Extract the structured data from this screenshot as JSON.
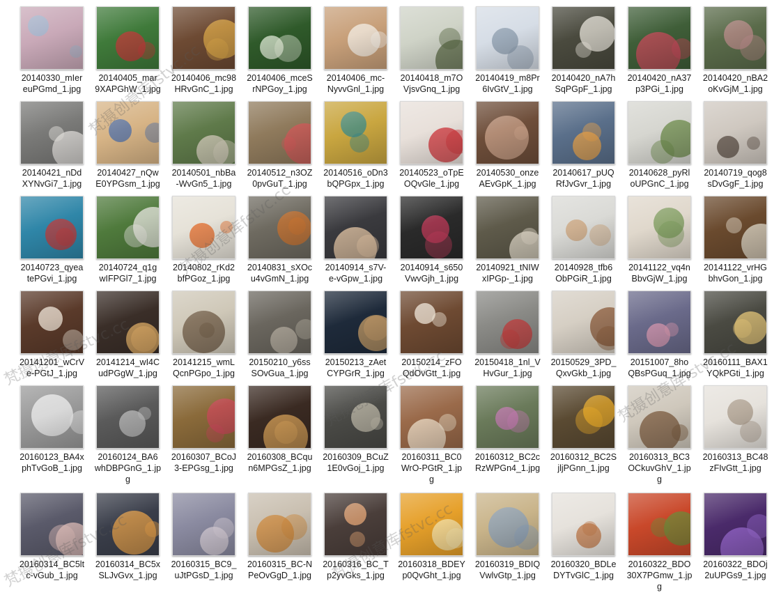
{
  "files": [
    {
      "name": "20140330_mIer euPGmd_1.jpg",
      "line1": "20140330_mIer",
      "line2": "euPGmd_1.jpg",
      "line3": "",
      "color": "#c9a9b8",
      "accent": "#9db7cf"
    },
    {
      "name": "20140405_mar 9XAPGhW_1.jpg",
      "line1": "20140405_mar",
      "line2": "9XAPGhW_1.jpg",
      "line3": "",
      "color": "#3f7a3a",
      "accent": "#c23b3b"
    },
    {
      "name": "20140406_mc98 HRvGnC_1.jpg",
      "line1": "20140406_mc98",
      "line2": "HRvGnC_1.jpg",
      "line3": "",
      "color": "#6d4a33",
      "accent": "#d9a74a"
    },
    {
      "name": "20140406_mceS rNPGoy_1.jpg",
      "line1": "20140406_mceS",
      "line2": "rNPGoy_1.jpg",
      "line3": "",
      "color": "#2f5a2a",
      "accent": "#dfe9d5"
    },
    {
      "name": "20140406_mc- NyvvGnl_1.jpg",
      "line1": "20140406_mc-",
      "line2": "NyvvGnl_1.jpg",
      "line3": "",
      "color": "#c8a07a",
      "accent": "#f3ede6"
    },
    {
      "name": "20140418_m7O VjsvGnq_1.jpg",
      "line1": "20140418_m7O",
      "line2": "VjsvGnq_1.jpg",
      "line3": "",
      "color": "#cfd3c7",
      "accent": "#5c6b47"
    },
    {
      "name": "20140419_m8Pr 6IvGtV_1.jpg",
      "line1": "20140419_m8Pr",
      "line2": "6IvGtV_1.jpg",
      "line3": "",
      "color": "#d6dde6",
      "accent": "#8a9aab"
    },
    {
      "name": "20140420_nA7h SqPGpF_1.jpg",
      "line1": "20140420_nA7h",
      "line2": "SqPGpF_1.jpg",
      "line3": "",
      "color": "#4a4a3e",
      "accent": "#e6e2d8"
    },
    {
      "name": "20140420_nA37 p3PGi_1.jpg",
      "line1": "20140420_nA37",
      "line2": "p3PGi_1.jpg",
      "line3": "",
      "color": "#3f5e38",
      "accent": "#c74a5a"
    },
    {
      "name": "20140420_nBA2 oKvGjM_1.jpg",
      "line1": "20140420_nBA2",
      "line2": "oKvGjM_1.jpg",
      "line3": "",
      "color": "#5a6b4a",
      "accent": "#b98a8a"
    },
    {
      "name": "20140421_nDd XYNvGi7_1.jpg",
      "line1": "20140421_nDd",
      "line2": "XYNvGi7_1.jpg",
      "line3": "",
      "color": "#7a7a78",
      "accent": "#e8e6e2"
    },
    {
      "name": "20140427_nQw E0YPGsm_1.jpg",
      "line1": "20140427_nQw",
      "line2": "E0YPGsm_1.jpg",
      "line3": "",
      "color": "#d7b486",
      "accent": "#4d6fa8"
    },
    {
      "name": "20140501_nbBa -WvGn5_1.jpg",
      "line1": "20140501_nbBa",
      "line2": "-WvGn5_1.jpg",
      "line3": "",
      "color": "#5f7a4a",
      "accent": "#d9d2c2"
    },
    {
      "name": "20140512_n3OZ 0pvGuT_1.jpg",
      "line1": "20140512_n3OZ",
      "line2": "0pvGuT_1.jpg",
      "line3": "",
      "color": "#8f7a5c",
      "accent": "#d45a5a"
    },
    {
      "name": "20140516_oDn3 bQPGpx_1.jpg",
      "line1": "20140516_oDn3",
      "line2": "bQPGpx_1.jpg",
      "line3": "",
      "color": "#c9a640",
      "accent": "#3a8a8a"
    },
    {
      "name": "20140523_oTpE OQvGle_1.jpg",
      "line1": "20140523_oTpE",
      "line2": "OQvGle_1.jpg",
      "line3": "",
      "color": "#e8e0da",
      "accent": "#d0343a"
    },
    {
      "name": "20140530_onze AEvGpK_1.jpg",
      "line1": "20140530_onze",
      "line2": "AEvGpK_1.jpg",
      "line3": "",
      "color": "#6e4e3a",
      "accent": "#c9a28a"
    },
    {
      "name": "20140617_pUQ RfJvGvr_1.jpg",
      "line1": "20140617_pUQ",
      "line2": "RfJvGvr_1.jpg",
      "line3": "",
      "color": "#5a6f8a",
      "accent": "#e6a04a"
    },
    {
      "name": "20140628_pyRl oUPGnC_1.jpg",
      "line1": "20140628_pyRl",
      "line2": "oUPGnC_1.jpg",
      "line3": "",
      "color": "#d6d6d0",
      "accent": "#6b8a4a"
    },
    {
      "name": "20140719_qog8 sDvGgF_1.jpg",
      "line1": "20140719_qog8",
      "line2": "sDvGgF_1.jpg",
      "line3": "",
      "color": "#cfc8c0",
      "accent": "#5a4e44"
    },
    {
      "name": "20140723_qyea tePGvi_1.jpg",
      "line1": "20140723_qyea",
      "line2": "tePGvi_1.jpg",
      "line3": "",
      "color": "#2f86a8",
      "accent": "#c23b3b"
    },
    {
      "name": "20140724_q1g wIFPGl7_1.jpg",
      "line1": "20140724_q1g",
      "line2": "wIFPGl7_1.jpg",
      "line3": "",
      "color": "#4f7a3c",
      "accent": "#e7e5e0"
    },
    {
      "name": "20140802_rKd2 bfPGoz_1.jpg",
      "line1": "20140802_rKd2",
      "line2": "bfPGoz_1.jpg",
      "line3": "",
      "color": "#e6e2d8",
      "accent": "#e06a2a"
    },
    {
      "name": "20140831_sXOc u4vGmN_1.jpg",
      "line1": "20140831_sXOc",
      "line2": "u4vGmN_1.jpg",
      "line3": "",
      "color": "#6e6a60",
      "accent": "#c9732f"
    },
    {
      "name": "20140914_s7V- e-vGpw_1.jpg",
      "line1": "20140914_s7V-",
      "line2": "e-vGpw_1.jpg",
      "line3": "",
      "color": "#3a3a3e",
      "accent": "#e8c9a8"
    },
    {
      "name": "20140914_s650 VwvGjh_1.jpg",
      "line1": "20140914_s650",
      "line2": "VwvGjh_1.jpg",
      "line3": "",
      "color": "#2a2a2a",
      "accent": "#c23b5a"
    },
    {
      "name": "20140921_tNIW xIPGp-_1.jpg",
      "line1": "20140921_tNIW",
      "line2": "xIPGp-_1.jpg",
      "line3": "",
      "color": "#5e5a4a",
      "accent": "#e8e0d0"
    },
    {
      "name": "20140928_tfb6 ObPGiR_1.jpg",
      "line1": "20140928_tfb6",
      "line2": "ObPGiR_1.jpg",
      "line3": "",
      "color": "#dadad6",
      "accent": "#c9a27a"
    },
    {
      "name": "20141122_vq4n BbvGjW_1.jpg",
      "line1": "20141122_vq4n",
      "line2": "BbvGjW_1.jpg",
      "line3": "",
      "color": "#e0d8cc",
      "accent": "#7a9a5a"
    },
    {
      "name": "20141122_vrHG bhvGon_1.jpg",
      "line1": "20141122_vrHG",
      "line2": "bhvGon_1.jpg",
      "line3": "",
      "color": "#6a4a2e",
      "accent": "#e6e0d0"
    },
    {
      "name": "20141201_wCrV e-PGtJ_1.jpg",
      "line1": "20141201_wCrV",
      "line2": "e-PGtJ_1.jpg",
      "line3": "",
      "color": "#5a3a2a",
      "accent": "#f0e6d8"
    },
    {
      "name": "20141214_wI4C udPGgW_1.jpg",
      "line1": "20141214_wI4C",
      "line2": "udPGgW_1.jpg",
      "line3": "",
      "color": "#3a2e28",
      "accent": "#e8b46a"
    },
    {
      "name": "20141215_wmL QcnPGpo_1.jpg",
      "line1": "20141215_wmL",
      "line2": "QcnPGpo_1.jpg",
      "line3": "",
      "color": "#cfc8b8",
      "accent": "#6e5a44"
    },
    {
      "name": "20150210_y6ss SOvGua_1.jpg",
      "line1": "20150210_y6ss",
      "line2": "SOvGua_1.jpg",
      "line3": "",
      "color": "#6a665e",
      "accent": "#b9b2a4"
    },
    {
      "name": "20150213_zAet CYPGrR_1.jpg",
      "line1": "20150213_zAet",
      "line2": "CYPGrR_1.jpg",
      "line3": "",
      "color": "#1e2a3a",
      "accent": "#c9a06a"
    },
    {
      "name": "20150214_zFO QdOvGtt_1.jpg",
      "line1": "20150214_zFO",
      "line2": "QdOvGtt_1.jpg",
      "line3": "",
      "color": "#6e4a32",
      "accent": "#efe6d8"
    },
    {
      "name": "20150418_1nl_V HvGur_1.jpg",
      "line1": "20150418_1nl_V",
      "line2": "HvGur_1.jpg",
      "line3": "",
      "color": "#8a8a86",
      "accent": "#c23b3b"
    },
    {
      "name": "20150529_3PD_ QxvGkb_1.jpg",
      "line1": "20150529_3PD_",
      "line2": "QxvGkb_1.jpg",
      "line3": "",
      "color": "#d6cfc4",
      "accent": "#8a5a3a"
    },
    {
      "name": "20151007_8ho QBsPGuq_1.jpg",
      "line1": "20151007_8ho",
      "line2": "QBsPGuq_1.jpg",
      "line3": "",
      "color": "#6a6a8a",
      "accent": "#d99ab0"
    },
    {
      "name": "20160111_BAX1 YQkPGti_1.jpg",
      "line1": "20160111_BAX1",
      "line2": "YQkPGti_1.jpg",
      "line3": "",
      "color": "#4a4a42",
      "accent": "#e6c77a"
    },
    {
      "name": "20160123_BA4x phTvGoB_1.jpg",
      "line1": "20160123_BA4x",
      "line2": "phTvGoB_1.jpg",
      "line3": "",
      "color": "#9a9a9a",
      "accent": "#ededed"
    },
    {
      "name": "20160124_BA6 whDBPGnG_1.jpg",
      "line1": "20160124_BA6",
      "line2": "whDBPGnG_1.jp",
      "line3": "g",
      "color": "#5a5a5a",
      "accent": "#bcbcbc"
    },
    {
      "name": "20160307_BCoJ 3-EPGsg_1.jpg",
      "line1": "20160307_BCoJ",
      "line2": "3-EPGsg_1.jpg",
      "line3": "",
      "color": "#8a6a3a",
      "accent": "#c94a5a"
    },
    {
      "name": "20160308_BCqu n6MPGsZ_1.jpg",
      "line1": "20160308_BCqu",
      "line2": "n6MPGsZ_1.jpg",
      "line3": "",
      "color": "#3a2a22",
      "accent": "#d9a35a"
    },
    {
      "name": "20160309_BCuZ 1E0vGoj_1.jpg",
      "line1": "20160309_BCuZ",
      "line2": "1E0vGoj_1.jpg",
      "line3": "",
      "color": "#4a4a46",
      "accent": "#bdb8a8"
    },
    {
      "name": "20160311_BC0 WrO-PGtR_1.jpg",
      "line1": "20160311_BC0",
      "line2": "WrO-PGtR_1.jp",
      "line3": "g",
      "color": "#9a6a4a",
      "accent": "#efe2cc"
    },
    {
      "name": "20160312_BC2c RzWPGn4_1.jpg",
      "line1": "20160312_BC2c",
      "line2": "RzWPGn4_1.jpg",
      "line3": "",
      "color": "#6a7a5a",
      "accent": "#c27ab0"
    },
    {
      "name": "20160312_BC2S jljPGnn_1.jpg",
      "line1": "20160312_BC2S",
      "line2": "jljPGnn_1.jpg",
      "line3": "",
      "color": "#5a4a32",
      "accent": "#e6a82a"
    },
    {
      "name": "20160313_BC3 OCkuvGhV_1.jpg",
      "line1": "20160313_BC3",
      "line2": "OCkuvGhV_1.jp",
      "line3": "g",
      "color": "#cfc8bc",
      "accent": "#7a5a3e"
    },
    {
      "name": "20160313_BC48 zFIvGtt_1.jpg",
      "line1": "20160313_BC48",
      "line2": "zFIvGtt_1.jpg",
      "line3": "",
      "color": "#e6e2dc",
      "accent": "#a89a8a"
    },
    {
      "name": "20160314_BC5lt c-vGub_1.jpg",
      "line1": "20160314_BC5lt",
      "line2": "c-vGub_1.jpg",
      "line3": "",
      "color": "#5a5a6a",
      "accent": "#e8c6c0"
    },
    {
      "name": "20160314_BC5x SLJvGvx_1.jpg",
      "line1": "20160314_BC5x",
      "line2": "SLJvGvx_1.jpg",
      "line3": "",
      "color": "#3a3e4a",
      "accent": "#e6a04a"
    },
    {
      "name": "20160315_BC9_ uJtPGsD_1.jpg",
      "line1": "20160315_BC9_",
      "line2": "uJtPGsD_1.jpg",
      "line3": "",
      "color": "#8a8aa0",
      "accent": "#d8cfd8"
    },
    {
      "name": "20160315_BC-N PeOvGgD_1.jpg",
      "line1": "20160315_BC-N",
      "line2": "PeOvGgD_1.jpg",
      "line3": "",
      "color": "#c9bfb0",
      "accent": "#c9863a"
    },
    {
      "name": "20160316_BC_T p2yvGks_1.jpg",
      "line1": "20160316_BC_T",
      "line2": "p2yvGks_1.jpg",
      "line3": "",
      "color": "#4a3e3a",
      "accent": "#e8a878"
    },
    {
      "name": "20160318_BDEY p0QvGht_1.jpg",
      "line1": "20160318_BDEY",
      "line2": "p0QvGht_1.jpg",
      "line3": "",
      "color": "#e6a02a",
      "accent": "#f6e6b0"
    },
    {
      "name": "20160319_BDIQ VwlvGtp_1.jpg",
      "line1": "20160319_BDIQ",
      "line2": "VwlvGtp_1.jpg",
      "line3": "",
      "color": "#c9b48a",
      "accent": "#8aa0b8"
    },
    {
      "name": "20160320_BDLe DYTvGlC_1.jpg",
      "line1": "20160320_BDLe",
      "line2": "DYTvGlC_1.jpg",
      "line3": "",
      "color": "#e6e2dc",
      "accent": "#c27a4a"
    },
    {
      "name": "20160322_BDO 30X7PGmw_1.jpg",
      "line1": "20160322_BDO",
      "line2": "30X7PGmw_1.jp",
      "line3": "g",
      "color": "#c9482a",
      "accent": "#6e8a3a"
    },
    {
      "name": "20160322_BDOj 2uUPGs9_1.jpg",
      "line1": "20160322_BDOj",
      "line2": "2uUPGs9_1.jpg",
      "line3": "",
      "color": "#4a2a6a",
      "accent": "#9a6ad0"
    }
  ],
  "watermarks": [
    "梵摄创意库fstvc.cc",
    "梵摄创意库fstvc.cc",
    "梵摄创意库fstvc.cc",
    "梵摄创意库fstvc.cc",
    "梵摄创意库fstvc.cc",
    "梵摄创意库fstvc.cc",
    "梵摄创意库fstvc.cc"
  ]
}
